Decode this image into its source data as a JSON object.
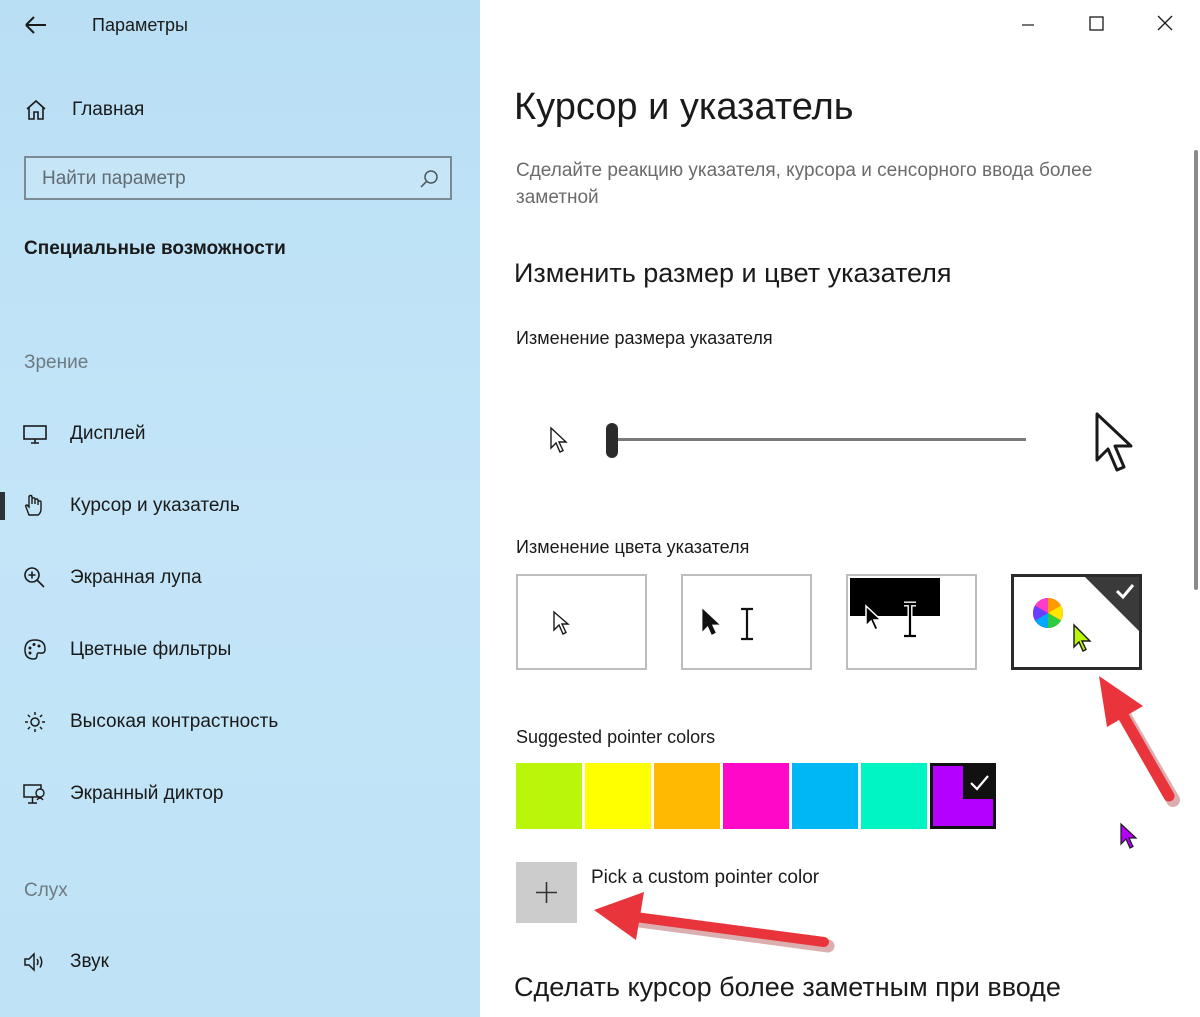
{
  "window": {
    "title": "Параметры",
    "controls": [
      "minimize-icon",
      "maximize-icon",
      "close-icon"
    ]
  },
  "sidebar": {
    "home_label": "Главная",
    "search_placeholder": "Найти параметр",
    "section_title": "Специальные возможности",
    "groups": [
      {
        "title": "Зрение",
        "items": [
          {
            "label": "Дисплей",
            "icon": "monitor-icon",
            "active": false
          },
          {
            "label": "Курсор и указатель",
            "icon": "pointer-hand-icon",
            "active": true
          },
          {
            "label": "Экранная лупа",
            "icon": "magnifier-icon",
            "active": false
          },
          {
            "label": "Цветные фильтры",
            "icon": "palette-icon",
            "active": false
          },
          {
            "label": "Высокая контрастность",
            "icon": "brightness-icon",
            "active": false
          },
          {
            "label": "Экранный диктор",
            "icon": "narrator-icon",
            "active": false
          }
        ]
      },
      {
        "title": "Слух",
        "items": [
          {
            "label": "Звук",
            "icon": "speaker-icon",
            "active": false
          }
        ]
      }
    ]
  },
  "main": {
    "title": "Курсор и указатель",
    "description": "Сделайте реакцию указателя, курсора и сенсорного ввода более заметной",
    "section1_title": "Изменить размер и цвет указателя",
    "size_label": "Изменение размера указателя",
    "pointer_size_value": 1,
    "color_label": "Изменение цвета указателя",
    "color_options": [
      {
        "id": "white",
        "selected": false
      },
      {
        "id": "black",
        "selected": false
      },
      {
        "id": "inverted",
        "selected": false
      },
      {
        "id": "custom",
        "selected": true
      }
    ],
    "suggested_label": "Suggested pointer colors",
    "suggested_colors": [
      "#b9f60a",
      "#ffff00",
      "#ffb900",
      "#ff08c8",
      "#00b7f5",
      "#00f5c4",
      "#b400ff"
    ],
    "selected_suggested": "#b400ff",
    "custom_color_label": "Pick a custom pointer color",
    "section2_title": "Сделать курсор более заметным при вводе"
  }
}
